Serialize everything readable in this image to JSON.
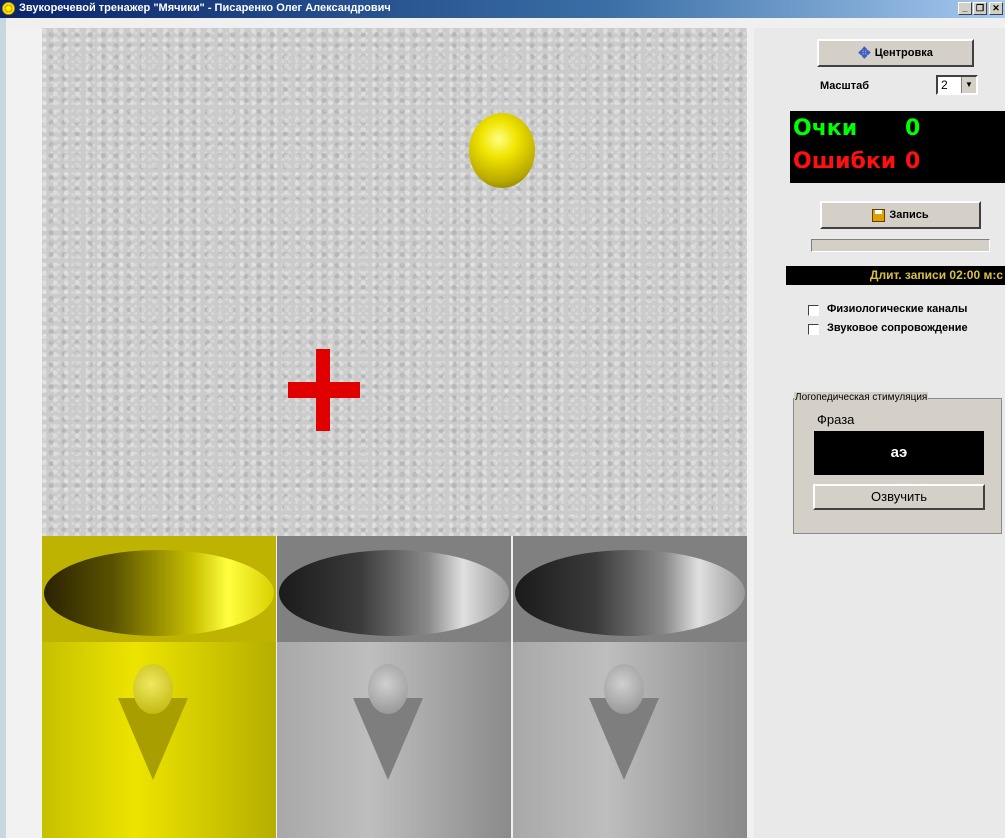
{
  "window": {
    "title": "Звукоречевой тренажер \"Мячики\" - Писаренко Олег Александрович",
    "minimize": "_",
    "restore": "❐",
    "close": "✕"
  },
  "controls": {
    "center_button": "Центровка",
    "center_icon": "move-arrows-icon",
    "scale_label": "Масштаб",
    "scale_value": "2",
    "record_button": "Запись",
    "record_icon": "floppy-disk-icon"
  },
  "score": {
    "points_label": "Очки",
    "points_value": "0",
    "points_color": "#00ff00",
    "errors_label": "Ошибки",
    "errors_value": "0",
    "errors_color": "#ff1010"
  },
  "recording": {
    "progress": 0,
    "duration_text": "Длит. записи 02:00 м:с"
  },
  "options": {
    "physio_channels": {
      "label": "Физиологические каналы",
      "checked": false
    },
    "sound_accompaniment": {
      "label": "Звуковое сопровождение",
      "checked": false
    }
  },
  "logopedic": {
    "group_title": "Логопедическая стимуляция",
    "phrase_label": "Фраза",
    "phrase_value": "аэ",
    "speak_button": "Озвучить"
  }
}
